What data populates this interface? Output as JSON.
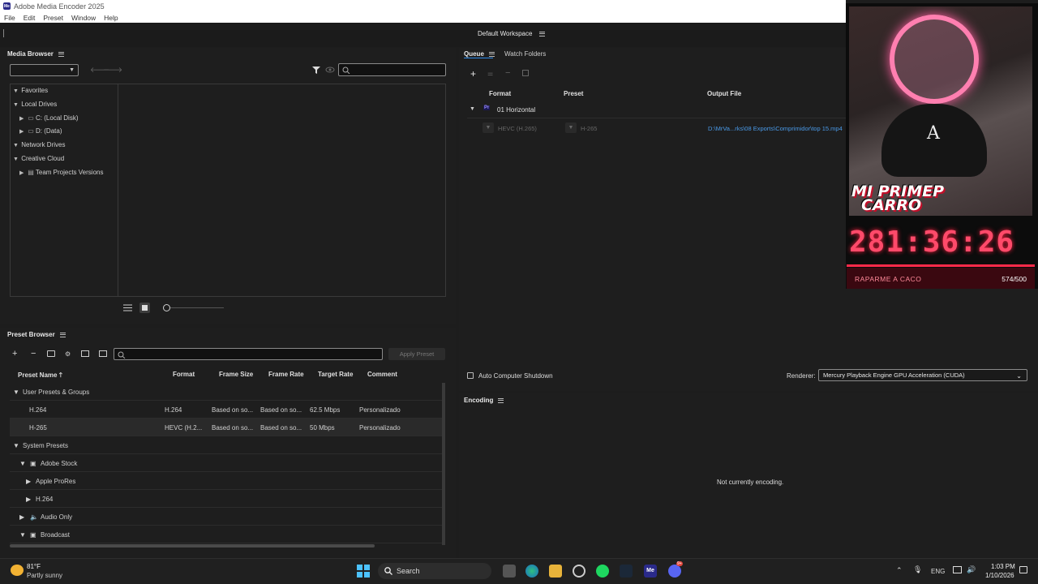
{
  "window": {
    "title": "Adobe Media Encoder 2025",
    "menu": [
      "File",
      "Edit",
      "Preset",
      "Window",
      "Help"
    ],
    "workspace": "Default Workspace"
  },
  "media_browser": {
    "title": "Media Browser",
    "tree": [
      {
        "label": "Favorites",
        "expanded": true,
        "level": 0
      },
      {
        "label": "Local Drives",
        "expanded": true,
        "level": 0
      },
      {
        "label": "C: (Local Disk)",
        "expanded": false,
        "level": 1
      },
      {
        "label": "D: (Data)",
        "expanded": false,
        "level": 1
      },
      {
        "label": "Network Drives",
        "expanded": true,
        "level": 0
      },
      {
        "label": "Creative Cloud",
        "expanded": true,
        "level": 0
      },
      {
        "label": "Team Projects Versions",
        "expanded": false,
        "level": 1
      }
    ]
  },
  "preset_browser": {
    "title": "Preset Browser",
    "apply_label": "Apply Preset",
    "columns": [
      "Preset Name",
      "Format",
      "Frame Size",
      "Frame Rate",
      "Target Rate",
      "Comment"
    ],
    "rows": [
      {
        "name": "User Presets & Groups",
        "group": true
      },
      {
        "name": "H.264",
        "format": "H.264",
        "frame_size": "Based on so...",
        "frame_rate": "Based on so...",
        "target_rate": "62.5 Mbps",
        "comment": "Personalizado"
      },
      {
        "name": "H-265",
        "format": "HEVC (H.2...",
        "frame_size": "Based on so...",
        "frame_rate": "Based on so...",
        "target_rate": "50 Mbps",
        "comment": "Personalizado"
      },
      {
        "name": "System Presets",
        "group": true
      },
      {
        "name": "Adobe Stock",
        "group": true
      },
      {
        "name": "Apple ProRes",
        "group": true
      },
      {
        "name": "H.264",
        "group": true
      },
      {
        "name": "Audio Only",
        "group": true
      },
      {
        "name": "Broadcast",
        "group": true
      }
    ]
  },
  "queue": {
    "tabs": [
      "Queue",
      "Watch Folders"
    ],
    "columns": [
      "Format",
      "Preset",
      "Output File"
    ],
    "item": {
      "name": "01 Horizontal",
      "format": "HEVC (H.265)",
      "preset": "H-265",
      "output": "D:\\MrVa...rks\\08 Exports\\Comprimidor\\top 15.mp4"
    },
    "auto_shutdown": "Auto Computer Shutdown",
    "renderer_label": "Renderer:",
    "renderer_value": "Mercury Playback Engine GPU Acceleration (CUDA)"
  },
  "encoding": {
    "title": "Encoding",
    "status": "Not currently encoding."
  },
  "overlay": {
    "banner_line1": "MI PRIMEP",
    "banner_line2": "CARRO",
    "timer": "281:36:26",
    "goal_label": "RAPARME A CACO",
    "goal_count": "574/500",
    "colors": {
      "accent": "#ff2a4a",
      "glow": "#ff7fb0"
    }
  },
  "taskbar": {
    "temp": "81°F",
    "weather": "Partly sunny",
    "search": "Search",
    "lang": "ENG",
    "time": "1:03 PM",
    "date": "1/10/2026",
    "badge": "9+"
  }
}
